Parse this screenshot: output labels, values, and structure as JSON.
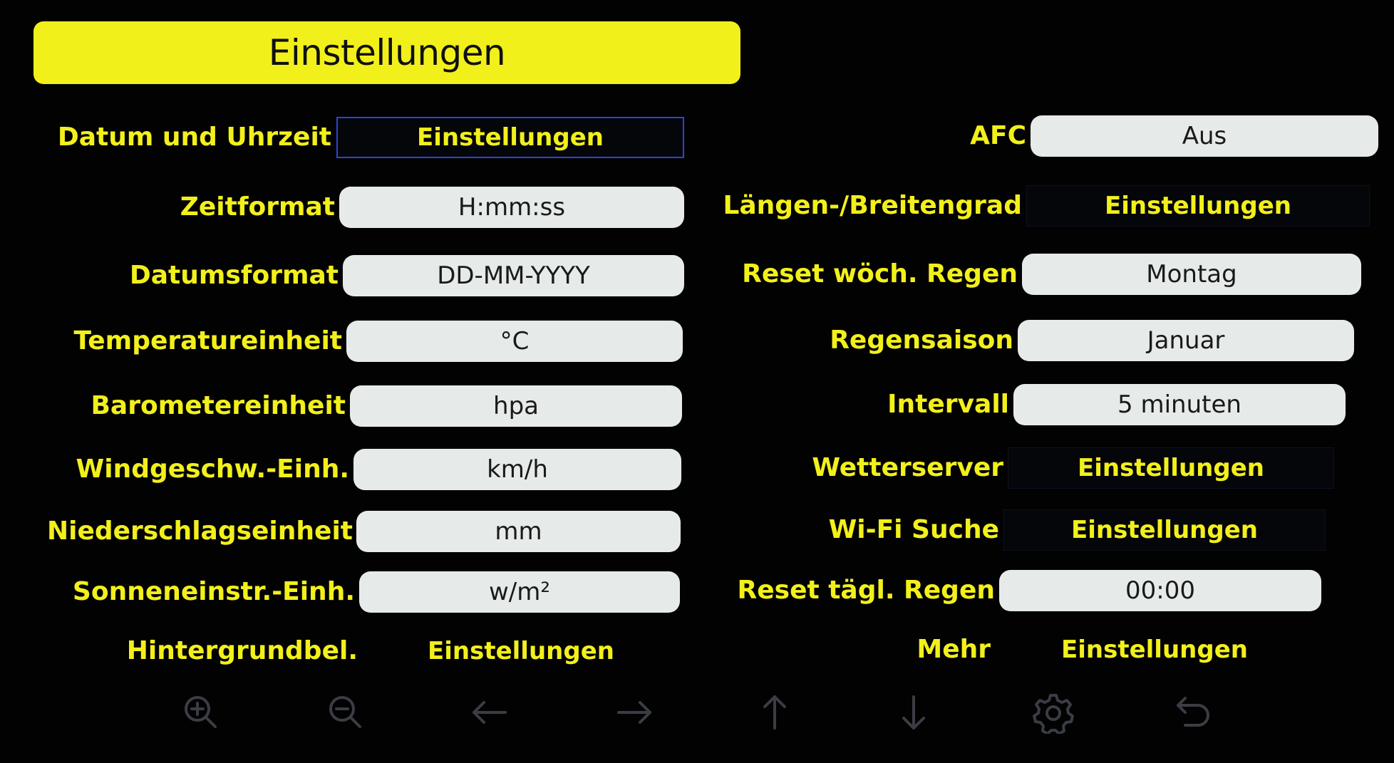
{
  "header": {
    "title": "Einstellungen"
  },
  "left": [
    {
      "label": "Datum und Uhrzeit",
      "value": "Einstellungen",
      "kind": "link-focused"
    },
    {
      "label": "Zeitformat",
      "value": "H:mm:ss",
      "kind": "pill"
    },
    {
      "label": "Datumsformat",
      "value": "DD-MM-YYYY",
      "kind": "pill"
    },
    {
      "label": "Temperatureinheit",
      "value": "°C",
      "kind": "pill"
    },
    {
      "label": "Barometereinheit",
      "value": "hpa",
      "kind": "pill"
    },
    {
      "label": "Windgeschw.-Einh.",
      "value": "km/h",
      "kind": "pill"
    },
    {
      "label": "Niederschlagseinheit",
      "value": "mm",
      "kind": "pill"
    },
    {
      "label": "Sonneneinstr.-Einh.",
      "value": "w/m²",
      "kind": "pill"
    },
    {
      "label": "Hintergrundbel.",
      "value": "Einstellungen",
      "kind": "link-plain"
    }
  ],
  "right": [
    {
      "label": "AFC",
      "value": "Aus",
      "kind": "pill"
    },
    {
      "label": "Längen-/Breitengrad",
      "value": "Einstellungen",
      "kind": "link"
    },
    {
      "label": "Reset wöch. Regen",
      "value": "Montag",
      "kind": "pill"
    },
    {
      "label": "Regensaison",
      "value": "Januar",
      "kind": "pill"
    },
    {
      "label": "Intervall",
      "value": "5 minuten",
      "kind": "pill"
    },
    {
      "label": "Wetterserver",
      "value": "Einstellungen",
      "kind": "link"
    },
    {
      "label": "Wi-Fi Suche",
      "value": "Einstellungen",
      "kind": "link"
    },
    {
      "label": "Reset tägl. Regen",
      "value": "00:00",
      "kind": "pill"
    },
    {
      "label": "Mehr",
      "value": "Einstellungen",
      "kind": "link"
    }
  ],
  "toolbar": {
    "icons": [
      "zoom-in-icon",
      "zoom-out-icon",
      "arrow-left-icon",
      "arrow-right-icon",
      "arrow-up-icon",
      "arrow-down-icon",
      "gear-icon",
      "back-icon"
    ]
  },
  "colors": {
    "accent": "#f2f01a",
    "background": "#020203",
    "pill": "#e6ebea",
    "focus": "#2a46d8",
    "toolbar_icon": "#3a3d44"
  }
}
